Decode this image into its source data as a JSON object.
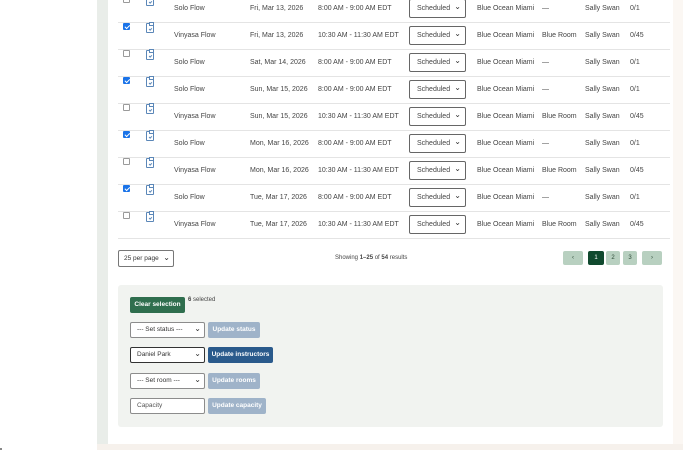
{
  "rows": [
    {
      "checked": false,
      "name": "Solo Flow",
      "date": "Fri, Mar 13, 2026",
      "time": "8:00 AM - 9:00 AM EDT",
      "status": "Scheduled",
      "location": "Blue Ocean Miami",
      "room": "—",
      "instructor": "Sally Swan",
      "capacity": "0/1"
    },
    {
      "checked": true,
      "name": "Vinyasa Flow",
      "date": "Fri, Mar 13, 2026",
      "time": "10:30 AM - 11:30 AM EDT",
      "status": "Scheduled",
      "location": "Blue Ocean Miami",
      "room": "Blue Room",
      "instructor": "Sally Swan",
      "capacity": "0/45"
    },
    {
      "checked": false,
      "name": "Solo Flow",
      "date": "Sat, Mar 14, 2026",
      "time": "8:00 AM - 9:00 AM EDT",
      "status": "Scheduled",
      "location": "Blue Ocean Miami",
      "room": "—",
      "instructor": "Sally Swan",
      "capacity": "0/1"
    },
    {
      "checked": true,
      "name": "Solo Flow",
      "date": "Sun, Mar 15, 2026",
      "time": "8:00 AM - 9:00 AM EDT",
      "status": "Scheduled",
      "location": "Blue Ocean Miami",
      "room": "—",
      "instructor": "Sally Swan",
      "capacity": "0/1"
    },
    {
      "checked": false,
      "name": "Vinyasa Flow",
      "date": "Sun, Mar 15, 2026",
      "time": "10:30 AM - 11:30 AM EDT",
      "status": "Scheduled",
      "location": "Blue Ocean Miami",
      "room": "Blue Room",
      "instructor": "Sally Swan",
      "capacity": "0/45"
    },
    {
      "checked": true,
      "name": "Solo Flow",
      "date": "Mon, Mar 16, 2026",
      "time": "8:00 AM - 9:00 AM EDT",
      "status": "Scheduled",
      "location": "Blue Ocean Miami",
      "room": "—",
      "instructor": "Sally Swan",
      "capacity": "0/1"
    },
    {
      "checked": false,
      "name": "Vinyasa Flow",
      "date": "Mon, Mar 16, 2026",
      "time": "10:30 AM - 11:30 AM EDT",
      "status": "Scheduled",
      "location": "Blue Ocean Miami",
      "room": "Blue Room",
      "instructor": "Sally Swan",
      "capacity": "0/45"
    },
    {
      "checked": true,
      "name": "Solo Flow",
      "date": "Tue, Mar 17, 2026",
      "time": "8:00 AM - 9:00 AM EDT",
      "status": "Scheduled",
      "location": "Blue Ocean Miami",
      "room": "—",
      "instructor": "Sally Swan",
      "capacity": "0/1"
    },
    {
      "checked": false,
      "name": "Vinyasa Flow",
      "date": "Tue, Mar 17, 2026",
      "time": "10:30 AM - 11:30 AM EDT",
      "status": "Scheduled",
      "location": "Blue Ocean Miami",
      "room": "Blue Room",
      "instructor": "Sally Swan",
      "capacity": "0/45"
    }
  ],
  "icons": {
    "row_icon": "clipboard-check-icon",
    "dropdown": "chevron-down-icon",
    "prev": "chevron-left-icon",
    "next": "chevron-right-icon"
  },
  "pagination": {
    "per_page": "25 per page",
    "showing_prefix": "Showing ",
    "showing_range": "1–25",
    "showing_of": " of ",
    "showing_total": "54",
    "showing_suffix": " results",
    "prev": "‹",
    "pages": [
      "1",
      "2",
      "3"
    ],
    "next": "›",
    "current_page": "1"
  },
  "bulk": {
    "clear_label": "Clear selection",
    "selected_count": "6",
    "selected_suffix": " selected",
    "status_select": "--- Set status ---",
    "update_status": "Update status",
    "instructor_select": "Daniel Park",
    "update_instructors": "Update instructors",
    "room_select": "--- Set room ---",
    "update_rooms": "Update rooms",
    "capacity_placeholder": "Capacity",
    "update_capacity": "Update capacity"
  },
  "colors": {
    "primary_green": "#10492e",
    "button_green": "#2f6e4e",
    "button_blue": "#2a5a8c",
    "button_disabled": "#9fb3c9",
    "checkbox_blue": "#1a73e8"
  }
}
